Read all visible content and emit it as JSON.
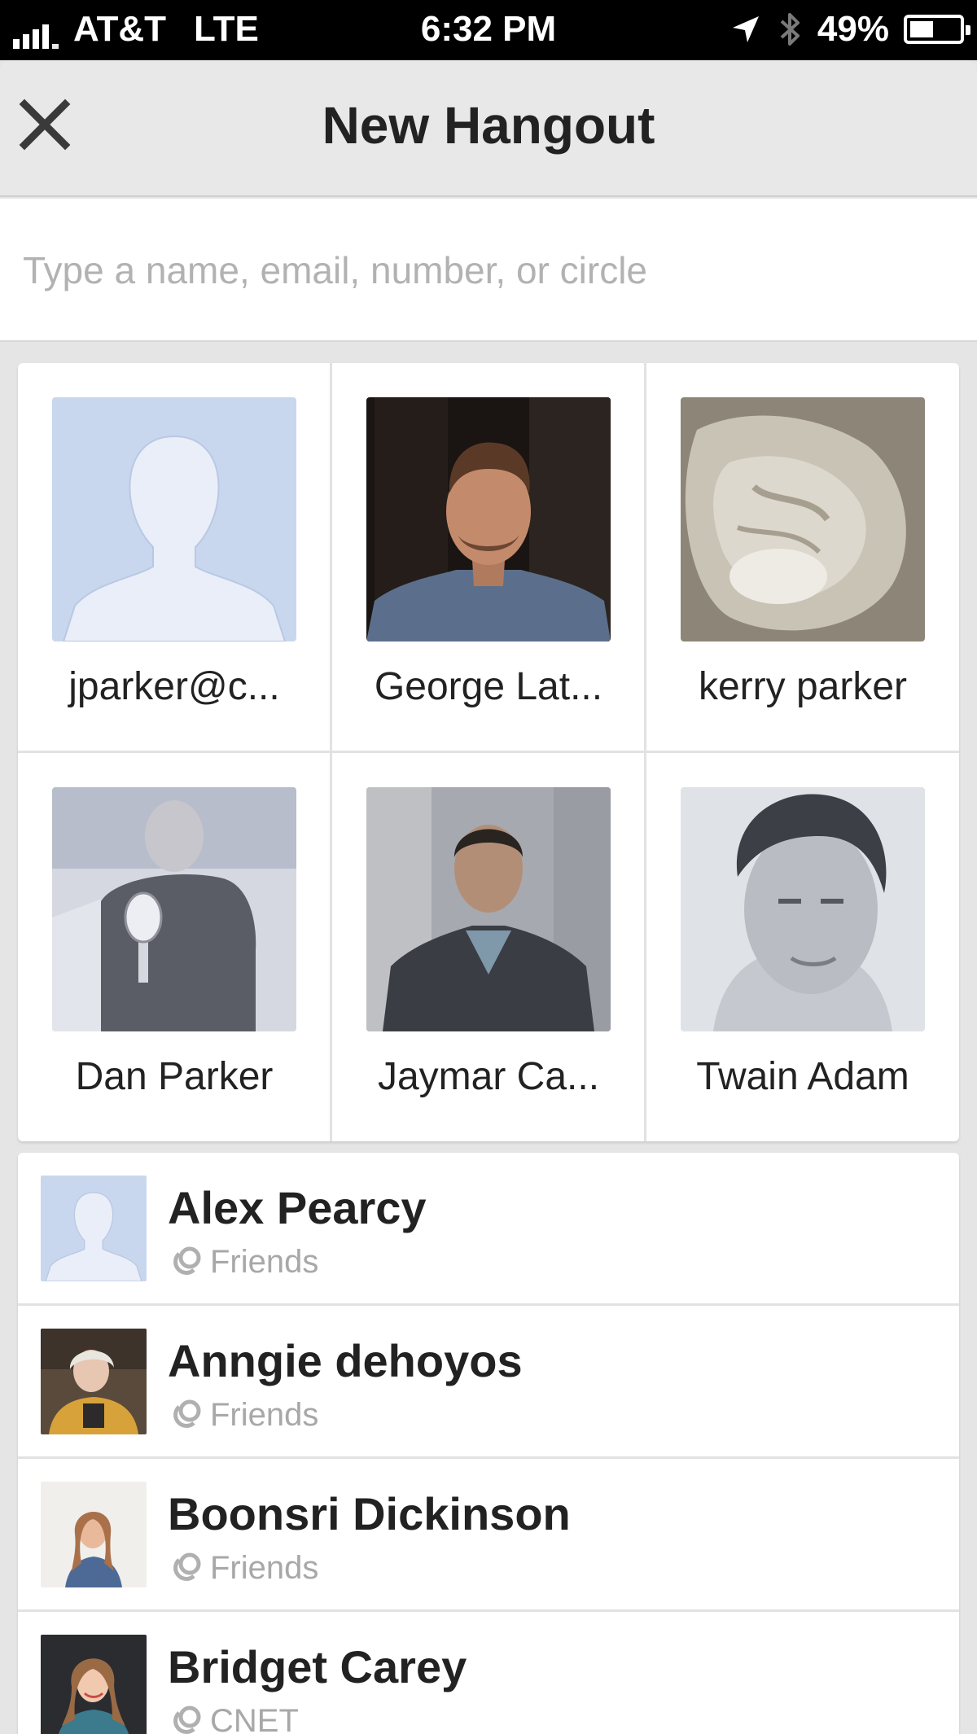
{
  "status_bar": {
    "carrier": "AT&T",
    "network": "LTE",
    "time": "6:32 PM",
    "battery": "49%",
    "battery_level": 0.49
  },
  "header": {
    "title": "New Hangout"
  },
  "search": {
    "placeholder": "Type a name, email, number, or circle",
    "value": ""
  },
  "favorites": [
    {
      "name": "jparker@c...",
      "avatar": "default-silhouette"
    },
    {
      "name": "George Lat...",
      "avatar": "photo"
    },
    {
      "name": "kerry parker",
      "avatar": "photo"
    },
    {
      "name": "Dan Parker",
      "avatar": "photo"
    },
    {
      "name": "Jaymar Ca...",
      "avatar": "photo"
    },
    {
      "name": "Twain Adam",
      "avatar": "photo"
    }
  ],
  "contacts": [
    {
      "name": "Alex Pearcy",
      "circle": "Friends",
      "avatar": "default-silhouette"
    },
    {
      "name": "Anngie dehoyos",
      "circle": "Friends",
      "avatar": "photo"
    },
    {
      "name": "Boonsri Dickinson",
      "circle": "Friends",
      "avatar": "photo"
    },
    {
      "name": "Bridget Carey",
      "circle": "CNET",
      "avatar": "photo"
    }
  ],
  "icons": {
    "close": "close-icon",
    "location": "location-arrow-icon",
    "bluetooth": "bluetooth-icon",
    "circle": "circle-link-icon"
  },
  "colors": {
    "header_bg": "#e8e8e8",
    "silhouette_bg": "#c9d7ee",
    "silhouette_fg": "#e9eef8",
    "secondary_text": "#a8a8a8"
  }
}
